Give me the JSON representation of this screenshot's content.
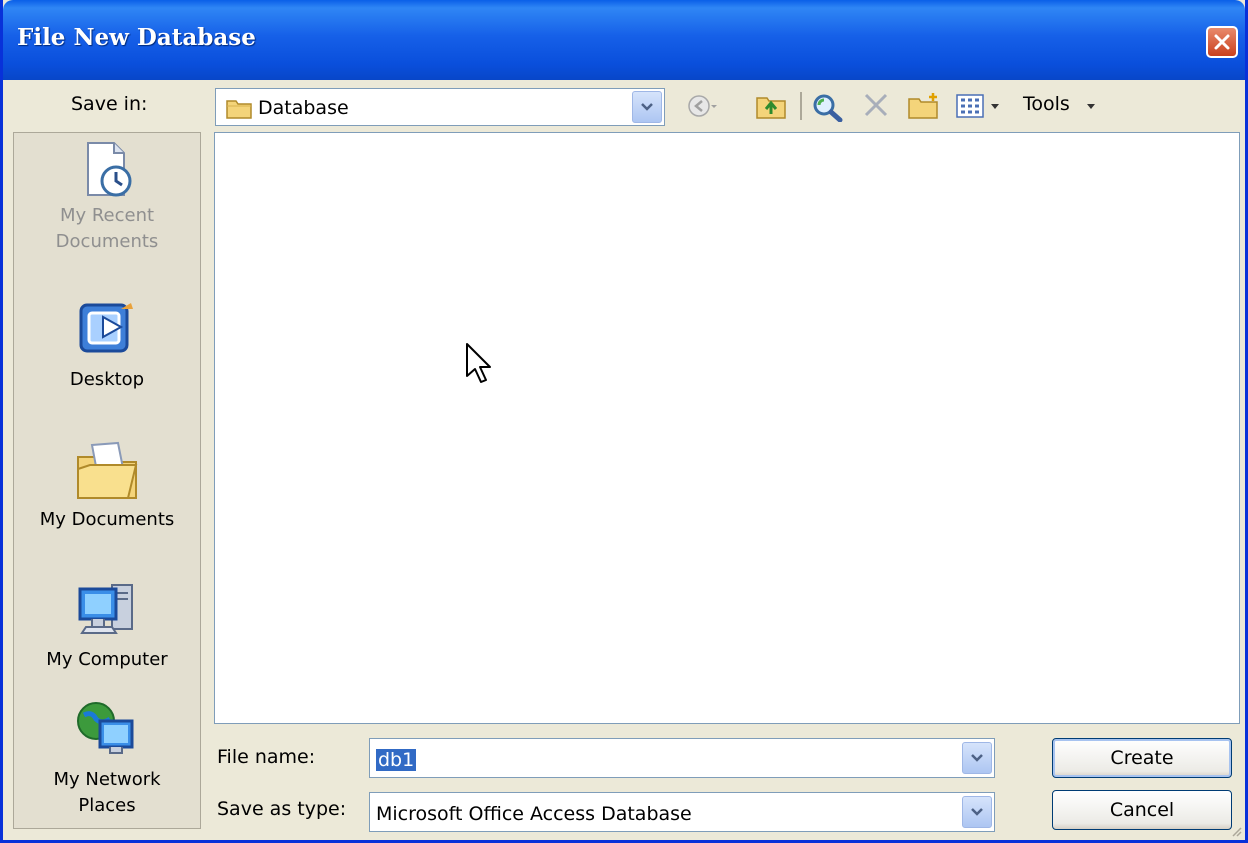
{
  "window": {
    "title": "File New Database"
  },
  "toolbar": {
    "save_in_label": "Save in:",
    "save_in_value": "Database",
    "tools_label": "Tools"
  },
  "places": [
    {
      "label_line1": "My Recent",
      "label_line2": "Documents",
      "icon": "recent-documents-icon"
    },
    {
      "label_line1": "Desktop",
      "label_line2": "",
      "icon": "desktop-icon"
    },
    {
      "label_line1": "My Documents",
      "label_line2": "",
      "icon": "my-documents-icon"
    },
    {
      "label_line1": "My Computer",
      "label_line2": "",
      "icon": "my-computer-icon"
    },
    {
      "label_line1": "My Network",
      "label_line2": "Places",
      "icon": "network-places-icon"
    }
  ],
  "form": {
    "file_name_label": "File name:",
    "file_name_value": "db1",
    "save_as_type_label": "Save as type:",
    "save_as_type_value": "Microsoft Office Access Database"
  },
  "buttons": {
    "create": "Create",
    "cancel": "Cancel"
  },
  "colors": {
    "titlebar": "#0a4fdc",
    "dialog_bg": "#ece9d8",
    "selection": "#316ac5",
    "close_button": "#c9401e"
  }
}
